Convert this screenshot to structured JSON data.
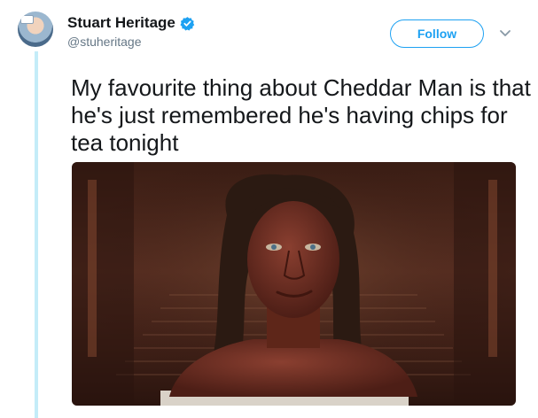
{
  "tweet": {
    "author": {
      "display_name": "Stuart Heritage",
      "handle": "@stuheritage",
      "verified": true
    },
    "follow_label": "Follow",
    "text": "My favourite thing about Cheddar Man is that he's just remembered he's having chips for tea tonight",
    "media": {
      "type": "photo",
      "subject": "bust-on-staircase"
    }
  },
  "colors": {
    "accent": "#1da1f2",
    "thread_line": "#c4ecf8",
    "text": "#14171a",
    "muted": "#657786"
  },
  "icons": {
    "verified": "verified-badge-icon",
    "menu": "chevron-down-icon"
  }
}
